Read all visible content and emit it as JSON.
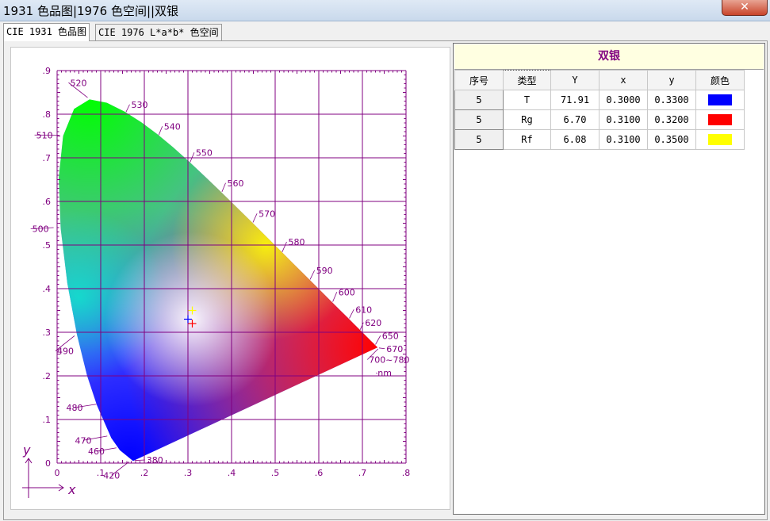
{
  "window": {
    "title": "1931 色品图|1976 色空间||双银",
    "close_glyph": "✕"
  },
  "tabs": [
    {
      "label": "CIE 1931 色品图",
      "active": true
    },
    {
      "label": "CIE 1976 L*a*b* 色空间",
      "active": false
    }
  ],
  "chart": {
    "x_ticks": [
      "0",
      ".1",
      ".2",
      ".3",
      ".4",
      ".5",
      ".6",
      ".7",
      ".8"
    ],
    "y_ticks": [
      "0",
      ".1",
      ".2",
      ".3",
      ".4",
      ".5",
      ".6",
      ".7",
      ".8",
      ".9"
    ],
    "x_axis_label": "x",
    "y_axis_label": "y",
    "wavelength_labels": [
      "380",
      "420",
      "460",
      "470",
      "480",
      "490",
      "500",
      "510",
      "520",
      "530",
      "540",
      "550",
      "560",
      "570",
      "580",
      "590",
      "600",
      "610",
      "620",
      "650",
      "670",
      "700~780",
      "nm"
    ],
    "line_color": "#800080"
  },
  "panel": {
    "sample_title": "双银",
    "columns": [
      "序号",
      "类型",
      "Y",
      "x",
      "y",
      "颜色"
    ],
    "rows": [
      {
        "idx": "5",
        "type": "T",
        "Y": "71.91",
        "x": "0.3000",
        "y": "0.3300",
        "color": "#0000ff"
      },
      {
        "idx": "5",
        "type": "Rg",
        "Y": "6.70",
        "x": "0.3100",
        "y": "0.3200",
        "color": "#ff0000"
      },
      {
        "idx": "5",
        "type": "Rf",
        "Y": "6.08",
        "x": "0.3100",
        "y": "0.3500",
        "color": "#ffff00"
      }
    ]
  },
  "chart_data": {
    "type": "scatter",
    "xlim": [
      0,
      0.8
    ],
    "ylim": [
      0,
      0.9
    ],
    "grid": true,
    "spectral_locus": [
      {
        "nm": "380",
        "x": 0.1741,
        "y": 0.005
      },
      {
        "nm": "420",
        "x": 0.1714,
        "y": 0.0051
      },
      {
        "nm": "460",
        "x": 0.144,
        "y": 0.0297
      },
      {
        "nm": "470",
        "x": 0.1241,
        "y": 0.0578
      },
      {
        "nm": "480",
        "x": 0.0913,
        "y": 0.1327
      },
      {
        "nm": "490",
        "x": 0.0454,
        "y": 0.295
      },
      {
        "nm": "500",
        "x": 0.0082,
        "y": 0.5384
      },
      {
        "nm": "510",
        "x": 0.0139,
        "y": 0.7502
      },
      {
        "nm": "520",
        "x": 0.0743,
        "y": 0.8338
      },
      {
        "nm": "530",
        "x": 0.1547,
        "y": 0.8059
      },
      {
        "nm": "540",
        "x": 0.2296,
        "y": 0.7543
      },
      {
        "nm": "550",
        "x": 0.3016,
        "y": 0.6923
      },
      {
        "nm": "560",
        "x": 0.3731,
        "y": 0.6245
      },
      {
        "nm": "570",
        "x": 0.4441,
        "y": 0.5547
      },
      {
        "nm": "580",
        "x": 0.5125,
        "y": 0.4866
      },
      {
        "nm": "590",
        "x": 0.5752,
        "y": 0.4242
      },
      {
        "nm": "600",
        "x": 0.627,
        "y": 0.3725
      },
      {
        "nm": "610",
        "x": 0.6658,
        "y": 0.334
      },
      {
        "nm": "620",
        "x": 0.6915,
        "y": 0.3083
      },
      {
        "nm": "650",
        "x": 0.726,
        "y": 0.274
      },
      {
        "nm": "670",
        "x": 0.7334,
        "y": 0.2666
      },
      {
        "nm": "700~780",
        "x": 0.7347,
        "y": 0.2653
      }
    ],
    "points": [
      {
        "label": "T",
        "x": 0.3,
        "y": 0.33,
        "color": "#0000ff"
      },
      {
        "label": "Rg",
        "x": 0.31,
        "y": 0.32,
        "color": "#ff0000"
      },
      {
        "label": "Rf",
        "x": 0.31,
        "y": 0.35,
        "color": "#ffff00"
      }
    ]
  }
}
